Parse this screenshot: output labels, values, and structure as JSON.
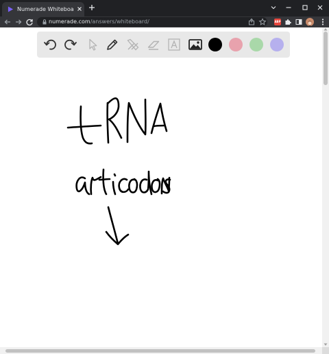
{
  "browser": {
    "tab_title": "Numerade Whiteboard",
    "url_host": "numerade.com",
    "url_path": "/answers/whiteboard/",
    "extension_badge": "ABP"
  },
  "icons": {
    "tab_favicon": "play-triangle-icon",
    "tab_close": "close-icon",
    "new_tab": "plus-icon",
    "window_controls": [
      "chevron-down-icon",
      "minimize-icon",
      "maximize-icon",
      "close-icon"
    ],
    "toolbar_left": [
      "back-arrow-icon",
      "forward-arrow-icon",
      "reload-icon"
    ],
    "toolbar_right": [
      "share-icon",
      "star-icon",
      "adblock-icon",
      "puzzle-icon",
      "sidebar-icon",
      "avatar",
      "kebab-menu-icon"
    ]
  },
  "whiteboard": {
    "tools": [
      "undo-icon",
      "redo-icon",
      "pointer-icon",
      "pen-icon",
      "tools-icon",
      "eraser-icon",
      "text-icon",
      "image-icon"
    ],
    "colors": [
      "#000000",
      "#e8a2ad",
      "#a9d8a9",
      "#b6b0ee"
    ],
    "selected_color": "#000000",
    "handwriting": [
      "tRNA",
      "anticodons"
    ]
  },
  "theme": {
    "chrome_dark": "#202124",
    "chrome_tab": "#35363a",
    "palette_bg": "#e8e8e8"
  }
}
